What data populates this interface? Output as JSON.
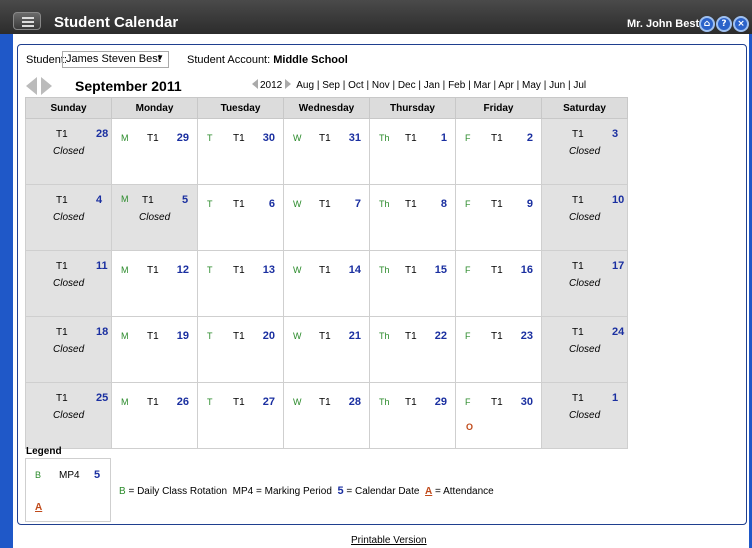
{
  "app": {
    "title": "Student Calendar",
    "user": "Mr. John Best"
  },
  "toolbar_icons": [
    "home-icon",
    "help-icon",
    "close-icon"
  ],
  "student": {
    "label": "Student:",
    "selected": "James Steven Best",
    "account_label": "Student Account:",
    "account_value": "Middle School"
  },
  "calendar": {
    "month_title": "September 2011",
    "year": "2012",
    "months": [
      "Aug",
      "Sep",
      "Oct",
      "Nov",
      "Dec",
      "Jan",
      "Feb",
      "Mar",
      "Apr",
      "May",
      "Jun",
      "Jul"
    ],
    "weekdays": [
      "Sunday",
      "Monday",
      "Tuesday",
      "Wednesday",
      "Thursday",
      "Friday",
      "Saturday"
    ],
    "closed_label": "Closed",
    "weeks": [
      [
        {
          "d": "28",
          "r": "T1",
          "closed": true
        },
        {
          "d": "29",
          "r": "T1",
          "l": "M"
        },
        {
          "d": "30",
          "r": "T1",
          "l": "T"
        },
        {
          "d": "31",
          "r": "T1",
          "l": "W"
        },
        {
          "d": "1",
          "r": "T1",
          "l": "Th"
        },
        {
          "d": "2",
          "r": "T1",
          "l": "F"
        },
        {
          "d": "3",
          "r": "T1",
          "closed": true
        }
      ],
      [
        {
          "d": "4",
          "r": "T1",
          "closed": true
        },
        {
          "d": "5",
          "r": "T1",
          "l": "M",
          "closed": true
        },
        {
          "d": "6",
          "r": "T1",
          "l": "T"
        },
        {
          "d": "7",
          "r": "T1",
          "l": "W"
        },
        {
          "d": "8",
          "r": "T1",
          "l": "Th"
        },
        {
          "d": "9",
          "r": "T1",
          "l": "F"
        },
        {
          "d": "10",
          "r": "T1",
          "closed": true
        }
      ],
      [
        {
          "d": "11",
          "r": "T1",
          "closed": true
        },
        {
          "d": "12",
          "r": "T1",
          "l": "M"
        },
        {
          "d": "13",
          "r": "T1",
          "l": "T"
        },
        {
          "d": "14",
          "r": "T1",
          "l": "W"
        },
        {
          "d": "15",
          "r": "T1",
          "l": "Th"
        },
        {
          "d": "16",
          "r": "T1",
          "l": "F"
        },
        {
          "d": "17",
          "r": "T1",
          "closed": true
        }
      ],
      [
        {
          "d": "18",
          "r": "T1",
          "closed": true
        },
        {
          "d": "19",
          "r": "T1",
          "l": "M"
        },
        {
          "d": "20",
          "r": "T1",
          "l": "T"
        },
        {
          "d": "21",
          "r": "T1",
          "l": "W"
        },
        {
          "d": "22",
          "r": "T1",
          "l": "Th"
        },
        {
          "d": "23",
          "r": "T1",
          "l": "F"
        },
        {
          "d": "24",
          "r": "T1",
          "closed": true
        }
      ],
      [
        {
          "d": "25",
          "r": "T1",
          "closed": true
        },
        {
          "d": "26",
          "r": "T1",
          "l": "M"
        },
        {
          "d": "27",
          "r": "T1",
          "l": "T"
        },
        {
          "d": "28",
          "r": "T1",
          "l": "W"
        },
        {
          "d": "29",
          "r": "T1",
          "l": "Th"
        },
        {
          "d": "30",
          "r": "T1",
          "l": "F",
          "att": "O"
        },
        {
          "d": "1",
          "r": "T1",
          "closed": true
        }
      ]
    ]
  },
  "legend": {
    "title": "Legend",
    "sample": {
      "rotation": "B",
      "period": "MP4",
      "date": "5",
      "attendance": "A"
    },
    "text": {
      "b": "B",
      "b_desc": "= Daily Class Rotation",
      "mp_desc": "MP4 = Marking Period",
      "five": "5",
      "five_desc": "= Calendar Date",
      "a": "A",
      "a_desc": "= Attendance"
    }
  },
  "footer": {
    "printable": "Printable Version"
  }
}
